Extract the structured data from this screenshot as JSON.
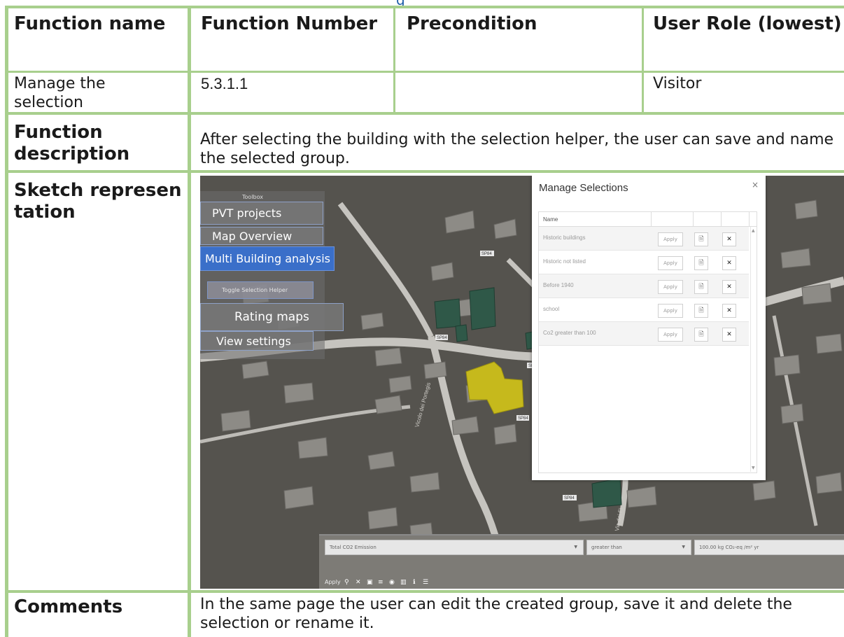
{
  "table": {
    "headers": [
      "Function name",
      "Function Number",
      "Precondition",
      "User Role (lowest)"
    ],
    "row1": {
      "function_name": "Manage the selection",
      "function_number": "5.3.1.1",
      "precondition": "",
      "user_role": "Visitor"
    },
    "description_label": "Function description",
    "description": "After selecting the building with the selection helper, the user can save and name the selected group.",
    "sketch_label": "Sketch representation",
    "comments_label": "Comments",
    "comments": "In the same page the user can edit the created group, save it and delete the selection or rename it."
  },
  "sketch": {
    "toolbox_label": "Toolbox",
    "menu": [
      "PVT projects",
      "Map Overview",
      "Multi Building analysis",
      "Toggle Selection Helper",
      "Rating maps",
      "View settings"
    ],
    "active_menu": "Multi Building analysis",
    "dialog": {
      "title": "Manage Selections",
      "close": "×",
      "column_name": "Name",
      "apply_label": "Apply",
      "rows": [
        "Historic buildings",
        "Historic not listed",
        "Before 1940",
        "school",
        "Co2 greater than 100"
      ]
    },
    "filter": {
      "field": "Total CO2 Emission",
      "operator": "greater than",
      "value": "100.00 kg CO₂-eq /m² yr"
    },
    "toolbar": {
      "apply": "Apply"
    },
    "road_labels": [
      "SP84",
      "SP84",
      "SP84",
      "SP84",
      "SP84"
    ],
    "street_labels": [
      "Vicolo dei Portegis",
      "Via dei Fi"
    ]
  }
}
